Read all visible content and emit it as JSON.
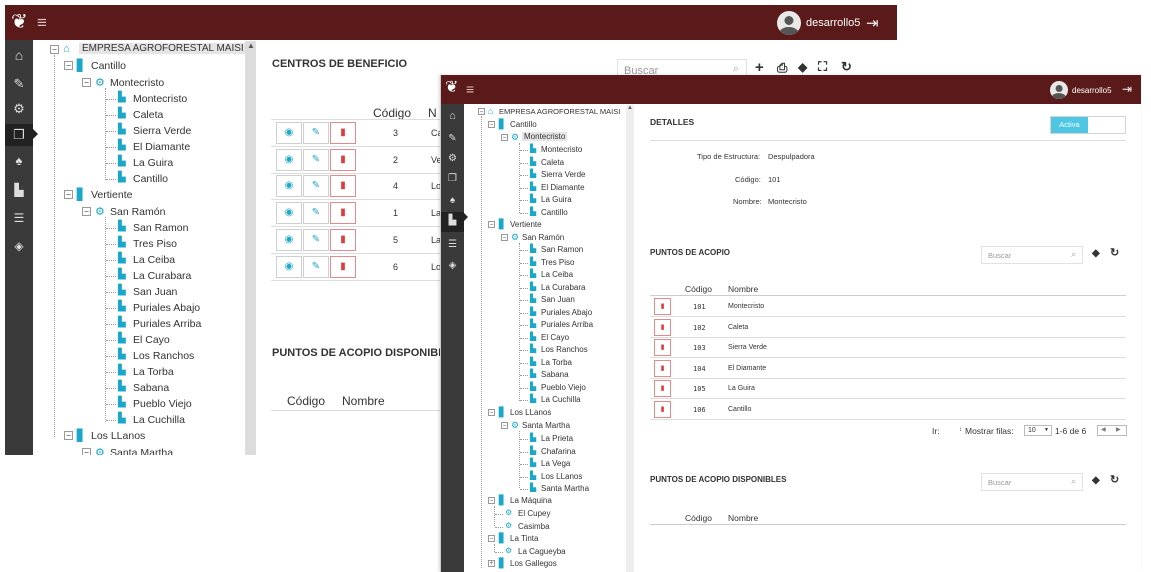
{
  "user": {
    "name": "desarrollo5"
  },
  "back": {
    "tree": {
      "root": "EMPRESA AGROFORESTAL MAISI",
      "cantillo": "Cantillo",
      "montecristo": "Montecristo",
      "montecristo_items": [
        "Montecristo",
        "Caleta",
        "Sierra Verde",
        "El Diamante",
        "La Guira",
        "Cantillo"
      ],
      "vertiente": "Vertiente",
      "sanramon": "San Ramón",
      "sanramon_items": [
        "San Ramon",
        "Tres Piso",
        "La Ceiba",
        "La Curabara",
        "San Juan",
        "Puriales Abajo",
        "Puriales Arriba",
        "El Cayo",
        "Los Ranchos",
        "La Torba",
        "Sabana",
        "Pueblo Viejo",
        "La Cuchilla"
      ],
      "llanos": "Los LLanos",
      "santamartha": "Santa Martha"
    },
    "centros_title": "CENTROS DE BENEFICIO",
    "search_placeholder": "Buscar",
    "col_codigo": "Código",
    "col_nombre": "N",
    "rows": [
      {
        "codigo": "3",
        "nombre": "Ca"
      },
      {
        "codigo": "2",
        "nombre": "Ve"
      },
      {
        "codigo": "4",
        "nombre": "Lo"
      },
      {
        "codigo": "1",
        "nombre": "La"
      },
      {
        "codigo": "5",
        "nombre": "La"
      },
      {
        "codigo": "6",
        "nombre": "Lo"
      }
    ],
    "disponibles_title": "PUNTOS DE ACOPIO DISPONIBL",
    "disp_codigo": "Código",
    "disp_nombre": "Nombre"
  },
  "front": {
    "tree": {
      "root": "EMPRESA AGROFORESTAL MAISI",
      "cantillo": "Cantillo",
      "montecristo": "Montecristo",
      "montecristo_items": [
        "Montecristo",
        "Caleta",
        "Sierra Verde",
        "El Diamante",
        "La Guira",
        "Cantillo"
      ],
      "vertiente": "Vertiente",
      "sanramon": "San Ramón",
      "sanramon_items": [
        "San Ramon",
        "Tres Piso",
        "La Ceiba",
        "La Curabara",
        "San Juan",
        "Puriales Abajo",
        "Puriales Arriba",
        "El Cayo",
        "Los Ranchos",
        "La Torba",
        "Sabana",
        "Pueblo Viejo",
        "La Cuchilla"
      ],
      "llanos": "Los LLanos",
      "santamartha": "Santa Martha",
      "santamartha_items": [
        "La Prieta",
        "Chafarina",
        "La Vega",
        "Los LLanos",
        "Santa Martha"
      ],
      "maquina": "La Máquina",
      "maquina_items": [
        "El Cupey",
        "Casimba"
      ],
      "tinta": "La Tinta",
      "tinta_items": [
        "La Cagueyba"
      ],
      "gallegos": "Los Gallegos"
    },
    "detalles_title": "DETALLES",
    "activa": "Activa",
    "tipo_label": "Tipo de Estructura:",
    "tipo_value": "Despulpadora",
    "codigo_label": "Código:",
    "codigo_value": "101",
    "nombre_label": "Nombre:",
    "nombre_value": "Montecristo",
    "puntos_title": "PUNTOS DE ACOPIO",
    "search_placeholder": "Buscar",
    "col_codigo": "Código",
    "col_nombre": "Nombre",
    "rows": [
      {
        "codigo": "101",
        "nombre": "Montecristo"
      },
      {
        "codigo": "102",
        "nombre": "Caleta"
      },
      {
        "codigo": "103",
        "nombre": "Sierra Verde"
      },
      {
        "codigo": "104",
        "nombre": "El Diamante"
      },
      {
        "codigo": "105",
        "nombre": "La Guira"
      },
      {
        "codigo": "106",
        "nombre": "Cantillo"
      }
    ],
    "ir_label": "Ir:",
    "mostrar_label": "Mostrar filas:",
    "rows_per_page": "10",
    "range": "1-6 de 6",
    "disponibles_title": "PUNTOS DE ACOPIO DISPONIBLES",
    "disp_codigo": "Código",
    "disp_nombre": "Nombre"
  }
}
